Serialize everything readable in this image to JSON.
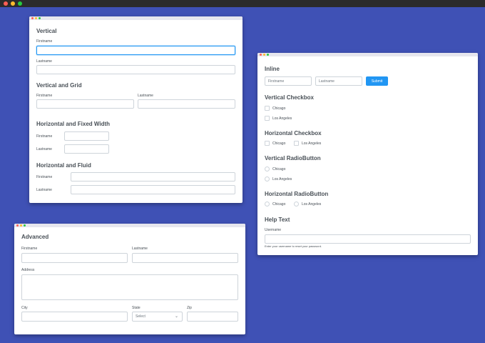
{
  "panel1": {
    "vertical": {
      "title": "Vertical",
      "firstname": "Firstname",
      "lastname": "Lastname"
    },
    "grid": {
      "title": "Vertical and Grid",
      "firstname": "Firstname",
      "lastname": "Lastname"
    },
    "fixed": {
      "title": "Horizontal and Fixed Width",
      "firstname": "Firstname",
      "lastname": "Lastname"
    },
    "fluid": {
      "title": "Horizontal and Fluid",
      "firstname": "Firstname",
      "lastname": "Lastname"
    }
  },
  "panel2": {
    "inline": {
      "title": "Inline",
      "firstname_placeholder": "Firstname",
      "lastname_placeholder": "Lastname",
      "submit": "Submit"
    },
    "vcheck": {
      "title": "Vertical Checkbox",
      "options": [
        "Chicago",
        "Los Angeles"
      ]
    },
    "hcheck": {
      "title": "Horizontal Checkbox",
      "options": [
        "Chicago",
        "Los Angeles"
      ]
    },
    "vradio": {
      "title": "Vertical RadioButton",
      "options": [
        "Chicago",
        "Los Angeles"
      ]
    },
    "hradio": {
      "title": "Horizontal RadioButton",
      "options": [
        "Chicago",
        "Los Angeles"
      ]
    },
    "help": {
      "title": "Help Text",
      "label": "Username",
      "text": "Enter your username to reset your password."
    }
  },
  "panel3": {
    "title": "Advanced",
    "firstname": "Firstname",
    "lastname": "Lastname",
    "address": "Address",
    "city": "City",
    "state": "State",
    "state_selected": "Select",
    "zip": "Zip"
  }
}
